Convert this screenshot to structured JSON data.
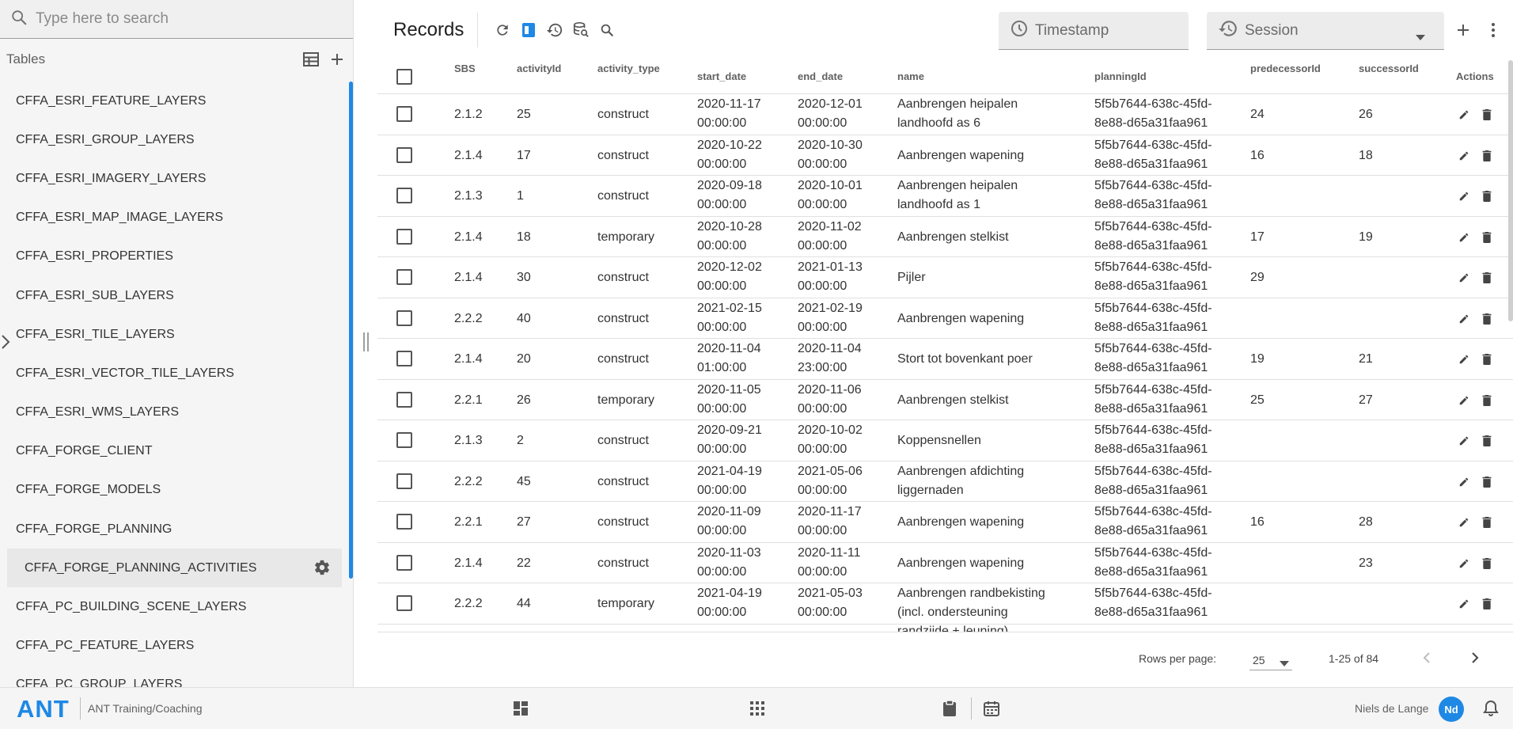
{
  "search": {
    "placeholder": "Type here to search"
  },
  "sidebar": {
    "title": "Tables",
    "items": [
      {
        "label": "CFFA_ESRI_FEATURE_LAYERS"
      },
      {
        "label": "CFFA_ESRI_GROUP_LAYERS"
      },
      {
        "label": "CFFA_ESRI_IMAGERY_LAYERS"
      },
      {
        "label": "CFFA_ESRI_MAP_IMAGE_LAYERS"
      },
      {
        "label": "CFFA_ESRI_PROPERTIES"
      },
      {
        "label": "CFFA_ESRI_SUB_LAYERS"
      },
      {
        "label": "CFFA_ESRI_TILE_LAYERS"
      },
      {
        "label": "CFFA_ESRI_VECTOR_TILE_LAYERS"
      },
      {
        "label": "CFFA_ESRI_WMS_LAYERS"
      },
      {
        "label": "CFFA_FORGE_CLIENT"
      },
      {
        "label": "CFFA_FORGE_MODELS"
      },
      {
        "label": "CFFA_FORGE_PLANNING"
      },
      {
        "label": "CFFA_FORGE_PLANNING_ACTIVITIES",
        "active": true
      },
      {
        "label": "CFFA_PC_BUILDING_SCENE_LAYERS"
      },
      {
        "label": "CFFA_PC_FEATURE_LAYERS"
      },
      {
        "label": "CFFA_PC_GROUP_LAYERS"
      }
    ]
  },
  "toolbar": {
    "title": "Records",
    "timestamp_label": "Timestamp",
    "session_label": "Session",
    "icons": [
      "refresh-icon",
      "panel-icon",
      "history-icon",
      "database-search-icon",
      "search-icon"
    ]
  },
  "table": {
    "columns": [
      "SBS",
      "activityId",
      "activity_type",
      "start_date",
      "end_date",
      "name",
      "planningId",
      "predecessorId",
      "successorId",
      "Actions"
    ],
    "rows": [
      {
        "sbs": "2.1.2",
        "activityId": "25",
        "type": "construct",
        "start": [
          "2020-11-17",
          "00:00:00"
        ],
        "end": [
          "2020-12-01",
          "00:00:00"
        ],
        "name": [
          "Aanbrengen heipalen",
          "landhoofd as 6"
        ],
        "planning": [
          "5f5b7644-638c-45fd-",
          "8e88-d65a31faa961"
        ],
        "pred": "24",
        "succ": "26"
      },
      {
        "sbs": "2.1.4",
        "activityId": "17",
        "type": "construct",
        "start": [
          "2020-10-22",
          "00:00:00"
        ],
        "end": [
          "2020-10-30",
          "00:00:00"
        ],
        "name": [
          "Aanbrengen wapening"
        ],
        "planning": [
          "5f5b7644-638c-45fd-",
          "8e88-d65a31faa961"
        ],
        "pred": "16",
        "succ": "18"
      },
      {
        "sbs": "2.1.3",
        "activityId": "1",
        "type": "construct",
        "start": [
          "2020-09-18",
          "00:00:00"
        ],
        "end": [
          "2020-10-01",
          "00:00:00"
        ],
        "name": [
          "Aanbrengen heipalen",
          "landhoofd as 1"
        ],
        "planning": [
          "5f5b7644-638c-45fd-",
          "8e88-d65a31faa961"
        ],
        "pred": "",
        "succ": ""
      },
      {
        "sbs": "2.1.4",
        "activityId": "18",
        "type": "temporary",
        "start": [
          "2020-10-28",
          "00:00:00"
        ],
        "end": [
          "2020-11-02",
          "00:00:00"
        ],
        "name": [
          "Aanbrengen stelkist"
        ],
        "planning": [
          "5f5b7644-638c-45fd-",
          "8e88-d65a31faa961"
        ],
        "pred": "17",
        "succ": "19"
      },
      {
        "sbs": "2.1.4",
        "activityId": "30",
        "type": "construct",
        "start": [
          "2020-12-02",
          "00:00:00"
        ],
        "end": [
          "2021-01-13",
          "00:00:00"
        ],
        "name": [
          "Pijler"
        ],
        "planning": [
          "5f5b7644-638c-45fd-",
          "8e88-d65a31faa961"
        ],
        "pred": "29",
        "succ": ""
      },
      {
        "sbs": "2.2.2",
        "activityId": "40",
        "type": "construct",
        "start": [
          "2021-02-15",
          "00:00:00"
        ],
        "end": [
          "2021-02-19",
          "00:00:00"
        ],
        "name": [
          "Aanbrengen wapening"
        ],
        "planning": [
          "5f5b7644-638c-45fd-",
          "8e88-d65a31faa961"
        ],
        "pred": "",
        "succ": ""
      },
      {
        "sbs": "2.1.4",
        "activityId": "20",
        "type": "construct",
        "start": [
          "2020-11-04",
          "01:00:00"
        ],
        "end": [
          "2020-11-04",
          "23:00:00"
        ],
        "name": [
          "Stort tot bovenkant poer"
        ],
        "planning": [
          "5f5b7644-638c-45fd-",
          "8e88-d65a31faa961"
        ],
        "pred": "19",
        "succ": "21"
      },
      {
        "sbs": "2.2.1",
        "activityId": "26",
        "type": "temporary",
        "start": [
          "2020-11-05",
          "00:00:00"
        ],
        "end": [
          "2020-11-06",
          "00:00:00"
        ],
        "name": [
          "Aanbrengen stelkist"
        ],
        "planning": [
          "5f5b7644-638c-45fd-",
          "8e88-d65a31faa961"
        ],
        "pred": "25",
        "succ": "27"
      },
      {
        "sbs": "2.1.3",
        "activityId": "2",
        "type": "construct",
        "start": [
          "2020-09-21",
          "00:00:00"
        ],
        "end": [
          "2020-10-02",
          "00:00:00"
        ],
        "name": [
          "Koppensnellen"
        ],
        "planning": [
          "5f5b7644-638c-45fd-",
          "8e88-d65a31faa961"
        ],
        "pred": "",
        "succ": ""
      },
      {
        "sbs": "2.2.2",
        "activityId": "45",
        "type": "construct",
        "start": [
          "2021-04-19",
          "00:00:00"
        ],
        "end": [
          "2021-05-06",
          "00:00:00"
        ],
        "name": [
          "Aanbrengen afdichting",
          "liggernaden"
        ],
        "planning": [
          "5f5b7644-638c-45fd-",
          "8e88-d65a31faa961"
        ],
        "pred": "",
        "succ": ""
      },
      {
        "sbs": "2.2.1",
        "activityId": "27",
        "type": "construct",
        "start": [
          "2020-11-09",
          "00:00:00"
        ],
        "end": [
          "2020-11-17",
          "00:00:00"
        ],
        "name": [
          "Aanbrengen wapening"
        ],
        "planning": [
          "5f5b7644-638c-45fd-",
          "8e88-d65a31faa961"
        ],
        "pred": "16",
        "succ": "28"
      },
      {
        "sbs": "2.1.4",
        "activityId": "22",
        "type": "construct",
        "start": [
          "2020-11-03",
          "00:00:00"
        ],
        "end": [
          "2020-11-11",
          "00:00:00"
        ],
        "name": [
          "Aanbrengen wapening"
        ],
        "planning": [
          "5f5b7644-638c-45fd-",
          "8e88-d65a31faa961"
        ],
        "pred": "",
        "succ": "23"
      },
      {
        "sbs": "2.2.2",
        "activityId": "44",
        "type": "temporary",
        "start": [
          "2021-04-19",
          "00:00:00"
        ],
        "end": [
          "2021-05-03",
          "00:00:00"
        ],
        "name": [
          "Aanbrengen randbekisting",
          "(incl. ondersteuning",
          "randzijde + leuning)"
        ],
        "planning": [
          "5f5b7644-638c-45fd-",
          "8e88-d65a31faa961"
        ],
        "pred": "",
        "succ": ""
      }
    ]
  },
  "pager": {
    "rows_per_page_label": "Rows per page:",
    "rows_per_page_value": "25",
    "range": "1-25 of 84"
  },
  "footer": {
    "logo": "ANT",
    "org": "ANT Training/Coaching",
    "user_name": "Niels de Lange",
    "avatar_initials": "Nd"
  },
  "colors": {
    "accent": "#1e88e5"
  }
}
